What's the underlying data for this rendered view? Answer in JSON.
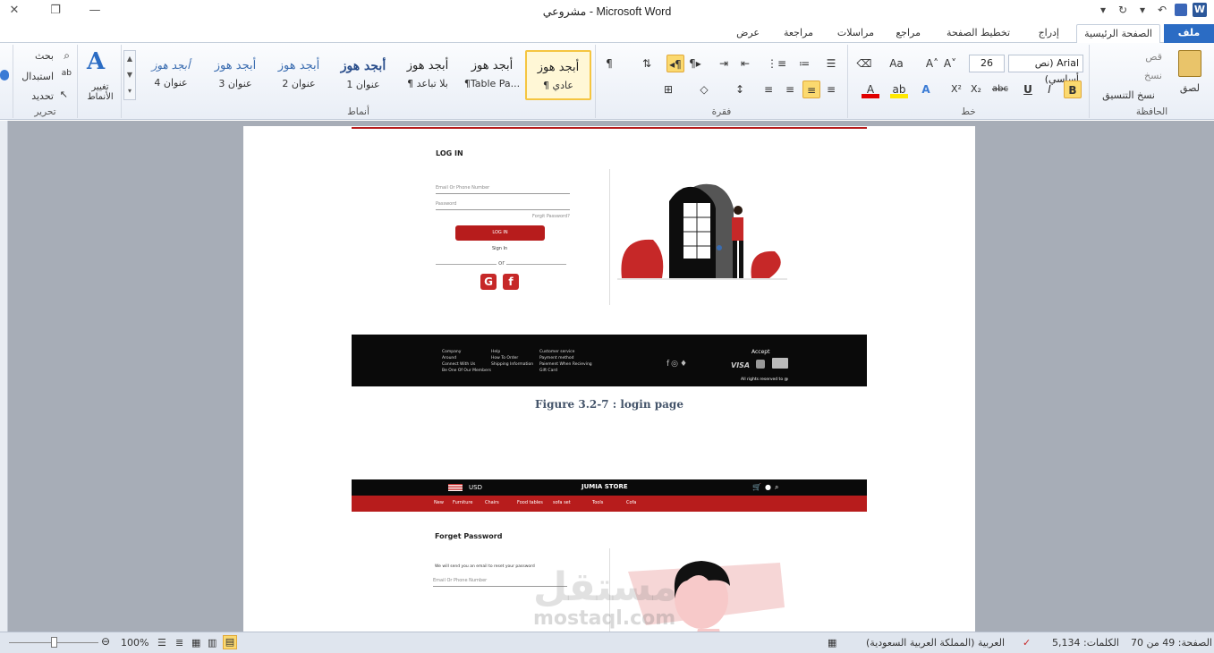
{
  "window": {
    "title": "مشروعي  -  Microsoft Word",
    "close": "✕",
    "restore": "❐",
    "minimize": "—"
  },
  "tabs": {
    "file": "ملف",
    "home": "الصفحة الرئيسية",
    "insert": "إدراج",
    "layout": "تخطيط الصفحة",
    "references": "مراجع",
    "mailings": "مراسلات",
    "review": "مراجعة",
    "view": "عرض"
  },
  "clipboard": {
    "paste": "لصق",
    "cut": "قص",
    "copy": "نسخ",
    "format_painter": "نسخ التنسيق",
    "group": "الحافظة"
  },
  "font": {
    "name": "Arial (نص أساسي)",
    "size": "26",
    "bold": "B",
    "italic": "I",
    "underline": "U",
    "strike": "abc",
    "subscript": "X₂",
    "superscript": "X²",
    "group": "خط"
  },
  "paragraph": {
    "group": "فقرة"
  },
  "styles": {
    "group": "أنماط",
    "items": [
      {
        "sample": "أبجد هوز",
        "name": "¶ عادي"
      },
      {
        "sample": "أبجد هوز",
        "name": "¶Table Pa..."
      },
      {
        "sample": "أبجد هوز",
        "name": "¶ بلا تباعد"
      },
      {
        "sample": "أبجد هوز",
        "name": "عنوان 1"
      },
      {
        "sample": "أبجد هوز",
        "name": "عنوان 2"
      },
      {
        "sample": "أبجد هوز",
        "name": "عنوان 3"
      },
      {
        "sample": "أبجد هوز",
        "name": "عنوان 4"
      }
    ],
    "change_styles": "تغيير الأنماط"
  },
  "editing": {
    "find": "بحث",
    "replace": "استبدال",
    "select": "تحديد",
    "group": "تحرير"
  },
  "document": {
    "login_title": "LOG IN",
    "email_placeholder": "Email Or Phone Number",
    "password_placeholder": "Password",
    "forgot": "Forgit Password?",
    "login_button": "LOG IN",
    "sign_in": "Sign In",
    "or": "or",
    "footer": {
      "col1": [
        "Company",
        "Around",
        "Connect With Us",
        "Be One Of Our Members"
      ],
      "col2": [
        "Help",
        "How To Order",
        "Shipping Information"
      ],
      "col3": [
        "Customer service",
        "Payment method",
        "Paiement When Recieving",
        "Gift Card"
      ],
      "accept": "Accept",
      "visa": "VISA",
      "rights": "All rights reserved to @"
    },
    "caption": "Figure 3.2-7 : login  page",
    "nav": {
      "currency": "USD",
      "brand": "JUMIA STORE",
      "menu": [
        "New",
        "Furniture",
        "Chairs",
        "Food tables",
        "sofa set",
        "Tools",
        "Cofa"
      ]
    },
    "fp_title": "Forget Password",
    "fp_text": "We will send you an email to reset your password",
    "fp_field": "Email Or Phone Number",
    "watermark": "مستقل",
    "watermark_en": "mostaql.com"
  },
  "status": {
    "page": "الصفحة: 49 من 70",
    "words": "الكلمات: 5,134",
    "language": "العربية (المملكة العربية السعودية)",
    "zoom": "100%"
  },
  "colors": {
    "accent": "#2b6cc4",
    "brand_red": "#b71c1c",
    "selection": "#fbd96f"
  }
}
